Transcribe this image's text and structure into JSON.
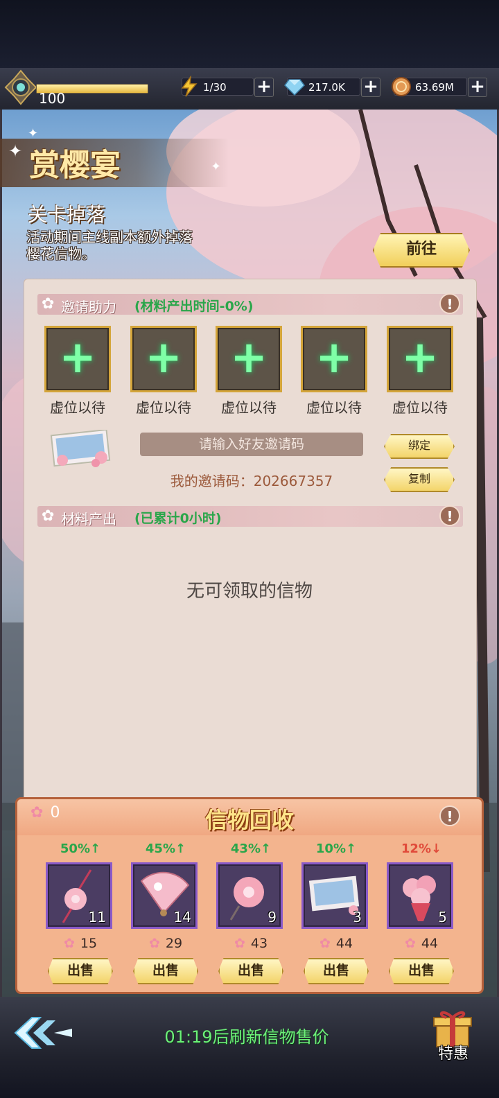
{
  "resources": {
    "level": "100",
    "level_progress": 1.0,
    "energy": "1/30",
    "gems": "217.0K",
    "coins": "63.69M",
    "plus": "+"
  },
  "event": {
    "title": "赏樱宴",
    "subtitle": "关卡掉落",
    "description": "活动期间主线副本额外掉落樱花信物。",
    "goto_label": "前往"
  },
  "invite": {
    "header_label": "邀请助力",
    "header_note": "(材料产出时间-0%)",
    "slots": [
      {
        "label": "虚位以待"
      },
      {
        "label": "虚位以待"
      },
      {
        "label": "虚位以待"
      },
      {
        "label": "虚位以待"
      },
      {
        "label": "虚位以待"
      }
    ],
    "input_placeholder": "请输入好友邀请码",
    "bind_label": "绑定",
    "copy_label": "复制",
    "my_code": "我的邀请码：202667357"
  },
  "materials": {
    "header_label": "材料产出",
    "header_note": "(已累计0小时)",
    "empty_message": "无可领取的信物"
  },
  "recycle": {
    "title": "信物回收",
    "petal_count": "0",
    "items": [
      {
        "name": "cherry-blossom-charm",
        "change": "50%↑",
        "trend": "up",
        "qty": "11",
        "price": "15",
        "sell_label": "出售"
      },
      {
        "name": "sakura-folding-fan",
        "change": "45%↑",
        "trend": "up",
        "qty": "14",
        "price": "29",
        "sell_label": "出售"
      },
      {
        "name": "sakura-hairpin",
        "change": "43%↑",
        "trend": "up",
        "qty": "9",
        "price": "43",
        "sell_label": "出售"
      },
      {
        "name": "sakura-postcard",
        "change": "10%↑",
        "trend": "up",
        "qty": "3",
        "price": "44",
        "sell_label": "出售"
      },
      {
        "name": "sakura-bouquet",
        "change": "12%↓",
        "trend": "down",
        "qty": "5",
        "price": "44",
        "sell_label": "出售"
      }
    ]
  },
  "footer": {
    "timer_text": "01:19后刷新信物售价",
    "special_offer_label": "特惠"
  },
  "colors": {
    "accent_gold": "#f1cf5a",
    "green_text": "#2aa64a",
    "red_text": "#e04a3a",
    "item_frame": "#8a5ac8"
  }
}
